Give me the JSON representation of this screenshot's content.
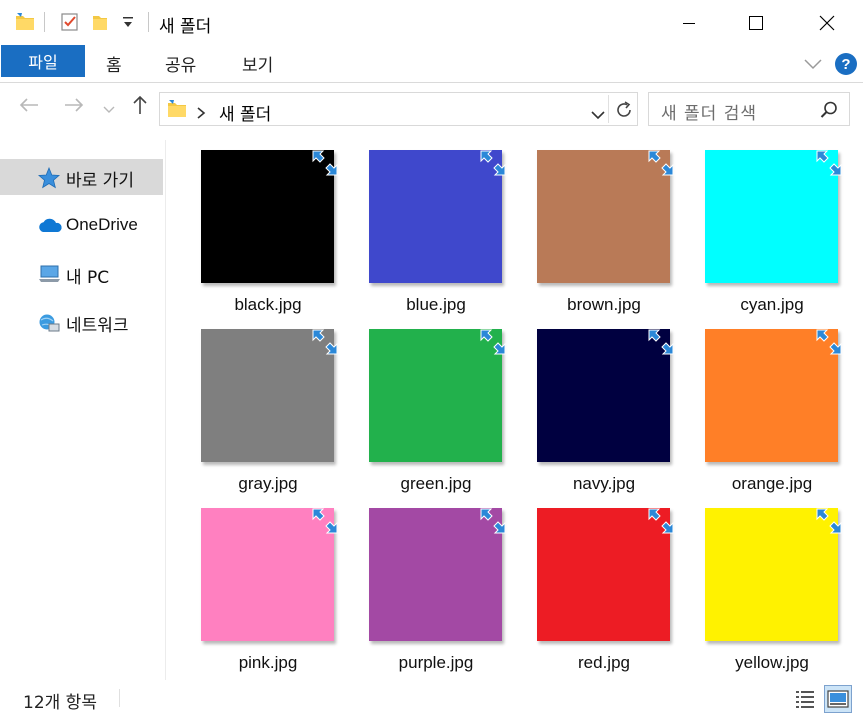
{
  "window": {
    "title": "새 폴더",
    "icons": [
      "folder-icon",
      "properties-check-icon",
      "new-folder-icon",
      "customize-dropdown-icon"
    ]
  },
  "ribbon": {
    "file_tab": "파일",
    "tabs": [
      "홈",
      "공유",
      "보기"
    ],
    "help_label": "?"
  },
  "address": {
    "path": "새 폴더",
    "search_placeholder": "새 폴더 검색"
  },
  "nav": {
    "items": [
      {
        "label": "바로 가기",
        "icon": "quick-access-star-icon",
        "selected": true
      },
      {
        "label": "OneDrive",
        "icon": "onedrive-cloud-icon",
        "selected": false
      },
      {
        "label": "내 PC",
        "icon": "this-pc-icon",
        "selected": false
      },
      {
        "label": "네트워크",
        "icon": "network-icon",
        "selected": false
      }
    ]
  },
  "files": [
    {
      "name": "black.jpg",
      "color": "#000000"
    },
    {
      "name": "blue.jpg",
      "color": "#3f48cc"
    },
    {
      "name": "brown.jpg",
      "color": "#b97a57"
    },
    {
      "name": "cyan.jpg",
      "color": "#00ffff"
    },
    {
      "name": "gray.jpg",
      "color": "#7f7f7f"
    },
    {
      "name": "green.jpg",
      "color": "#22b14c"
    },
    {
      "name": "navy.jpg",
      "color": "#000040"
    },
    {
      "name": "orange.jpg",
      "color": "#ff7f27"
    },
    {
      "name": "pink.jpg",
      "color": "#ff80c0"
    },
    {
      "name": "purple.jpg",
      "color": "#a349a4"
    },
    {
      "name": "red.jpg",
      "color": "#ed1c24"
    },
    {
      "name": "yellow.jpg",
      "color": "#fff200"
    }
  ],
  "status": {
    "item_count": "12개 항목"
  },
  "colors": {
    "accent": "#1a6ec2",
    "selection": "#d9d9d9",
    "sync_badge": "#2b88d8"
  }
}
